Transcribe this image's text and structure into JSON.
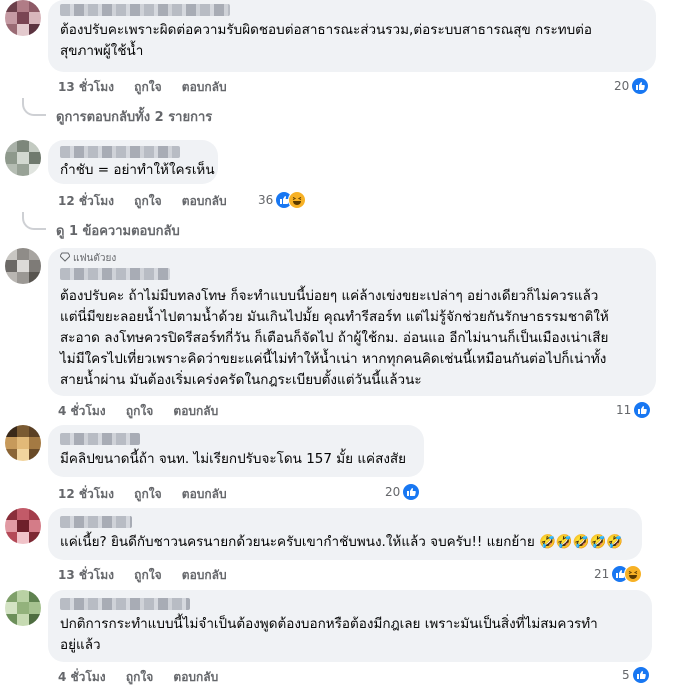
{
  "comments": [
    {
      "text": "ต้องปรับคะเพราะผิดต่อความรับผิดชอบต่อสาธารณะส่วนรวม,ต่อระบบสาธารณสุข กระทบต่อ\nสุขภาพผู้ใช้น้ำ",
      "time": "13 ชั่วโมง",
      "like": "ถูกใจ",
      "reply": "ตอบกลับ",
      "reaction_count": "20",
      "reactions": [
        "like-icon"
      ],
      "view_replies": "ดูการตอบกลับทั้ง 2 รายการ"
    },
    {
      "text": "กำชับ = อย่าทำให้ใครเห็น",
      "time": "12 ชั่วโมง",
      "like": "ถูกใจ",
      "reply": "ตอบกลับ",
      "reaction_count": "36",
      "reactions": [
        "like-icon",
        "haha-icon"
      ],
      "view_replies": "ดู 1 ข้อความตอบกลับ"
    },
    {
      "badge": "แฟนตัวยง",
      "text": "ต้องปรับคะ ถ้าไม่มีบทลงโทษ ก็จะทำแบบนี้บ่อยๆ แค่ล้างเข่งขยะเปล่าๆ อย่างเดียวก็ไม่ควรแล้ว\nแต่นี่มีขยะลอยน้ำไปตามน้ำด้วย มันเกินไปมั้ย คุณทำรีสอร์ท แต่ไม่รู้จักช่วยกันรักษาธรรมชาติให้\nสะอาด ลงโทษควรปิดรีสอร์ทกี่วัน ก็เตือนก็จัดไป ถ้าผู้ใช้กม. อ่อนแอ อีกไม่นานก็เป็นเมืองเน่าเสีย\nไม่มีใครไปเที่ยวเพราะคิดว่าขยะแค่นี้ไม่ทำให้น้ำเน่า หากทุกคนคิดเช่นนี้เหมือนกันต่อไปก็เน่าทั้ง\nสายน้ำผ่าน มันต้องเริ่มเคร่งครัดในกฎระเบียบตั้งแต่วันนี้แล้วนะ",
      "time": "4 ชั่วโมง",
      "like": "ถูกใจ",
      "reply": "ตอบกลับ",
      "reaction_count": "11",
      "reactions": [
        "like-icon"
      ]
    },
    {
      "text": "มีคลิปขนาดนี้ถ้า จนท. ไม่เรียกปรับจะโดน 157 มั้ย แค่สงสัย",
      "time": "12 ชั่วโมง",
      "like": "ถูกใจ",
      "reply": "ตอบกลับ",
      "reaction_count": "20",
      "reactions": [
        "like-icon"
      ]
    },
    {
      "text": "แค่เนี้ย? ยินดีกับชาวนครนายกด้วยนะครับเขากำชับพนง.ให้แล้ว จบครับ!! แยกย้าย 🤣🤣🤣🤣🤣",
      "time": "13 ชั่วโมง",
      "like": "ถูกใจ",
      "reply": "ตอบกลับ",
      "reaction_count": "21",
      "reactions": [
        "like-icon",
        "haha-icon"
      ]
    },
    {
      "text": "ปกติการกระทำแบบนี้ไม่จำเป็นต้องพูดต้องบอกหรือต้องมีกฎเลย เพราะมันเป็นสิ่งที่ไม่สมควรทำ\nอยู่แล้ว",
      "time": "4 ชั่วโมง",
      "like": "ถูกใจ",
      "reply": "ตอบกลับ",
      "reaction_count": "5",
      "reactions": [
        "like-icon"
      ]
    }
  ],
  "colors": {
    "like": "#1877f2",
    "haha": "#f7b125",
    "bubble": "#f0f2f5",
    "meta": "#65676b"
  }
}
